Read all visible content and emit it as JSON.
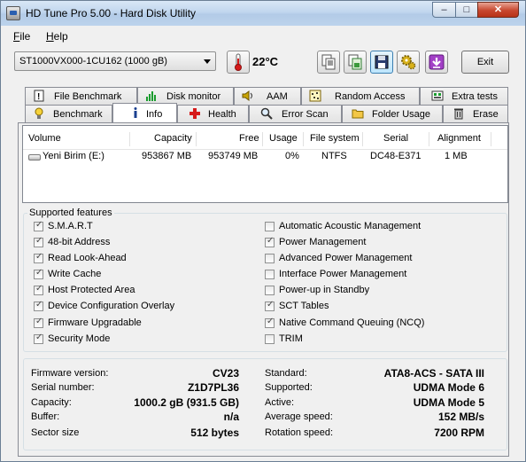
{
  "window": {
    "title": "HD Tune Pro 5.00 - Hard Disk Utility",
    "min_glyph": "–",
    "max_glyph": "□",
    "close_glyph": "✕"
  },
  "menu": {
    "file": {
      "u": "F",
      "rest": "ile"
    },
    "help": {
      "u": "H",
      "rest": "elp"
    }
  },
  "toolbar": {
    "drive": "ST1000VX000-1CU162 (1000 gB)",
    "temperature": "22°C",
    "exit": "Exit"
  },
  "tabs_top": [
    "File Benchmark",
    "Disk monitor",
    "AAM",
    "Random Access",
    "Extra tests"
  ],
  "tabs_bottom": [
    "Benchmark",
    "Info",
    "Health",
    "Error Scan",
    "Folder Usage",
    "Erase"
  ],
  "volumes": {
    "headers": [
      "Volume",
      "Capacity",
      "Free",
      "Usage",
      "File system",
      "Serial",
      "Alignment"
    ],
    "rows": [
      {
        "volume": "Yeni Birim (E:)",
        "capacity": "953867 MB",
        "free": "953749 MB",
        "usage": "0%",
        "fs": "NTFS",
        "serial": "DC48-E371",
        "alignment": "1 MB"
      }
    ]
  },
  "features": {
    "title": "Supported features",
    "left": [
      {
        "label": "S.M.A.R.T",
        "checked": true
      },
      {
        "label": "48-bit Address",
        "checked": true
      },
      {
        "label": "Read Look-Ahead",
        "checked": true
      },
      {
        "label": "Write Cache",
        "checked": true
      },
      {
        "label": "Host Protected Area",
        "checked": true
      },
      {
        "label": "Device Configuration Overlay",
        "checked": true
      },
      {
        "label": "Firmware Upgradable",
        "checked": true
      },
      {
        "label": "Security Mode",
        "checked": true
      }
    ],
    "right": [
      {
        "label": "Automatic Acoustic Management",
        "checked": false
      },
      {
        "label": "Power Management",
        "checked": true
      },
      {
        "label": "Advanced Power Management",
        "checked": false
      },
      {
        "label": "Interface Power Management",
        "checked": false
      },
      {
        "label": "Power-up in Standby",
        "checked": false
      },
      {
        "label": "SCT Tables",
        "checked": true
      },
      {
        "label": "Native Command Queuing (NCQ)",
        "checked": true
      },
      {
        "label": "TRIM",
        "checked": false
      }
    ],
    "check_glyph": "✓"
  },
  "info": {
    "left": [
      {
        "label": "Firmware version:",
        "value": "CV23"
      },
      {
        "label": "Serial number:",
        "value": "Z1D7PL36"
      },
      {
        "label": "Capacity:",
        "value": "1000.2 gB (931.5 GB)"
      },
      {
        "label": "Buffer:",
        "value": "n/a"
      },
      {
        "label": "Sector size",
        "value": "512 bytes"
      }
    ],
    "right": [
      {
        "label": "Standard:",
        "value": "ATA8-ACS - SATA III"
      },
      {
        "label": "Supported:",
        "value": "UDMA Mode 6"
      },
      {
        "label": "Active:",
        "value": "UDMA Mode 5"
      },
      {
        "label": "Average speed:",
        "value": "152 MB/s"
      },
      {
        "label": "Rotation speed:",
        "value": "7200 RPM"
      }
    ]
  }
}
